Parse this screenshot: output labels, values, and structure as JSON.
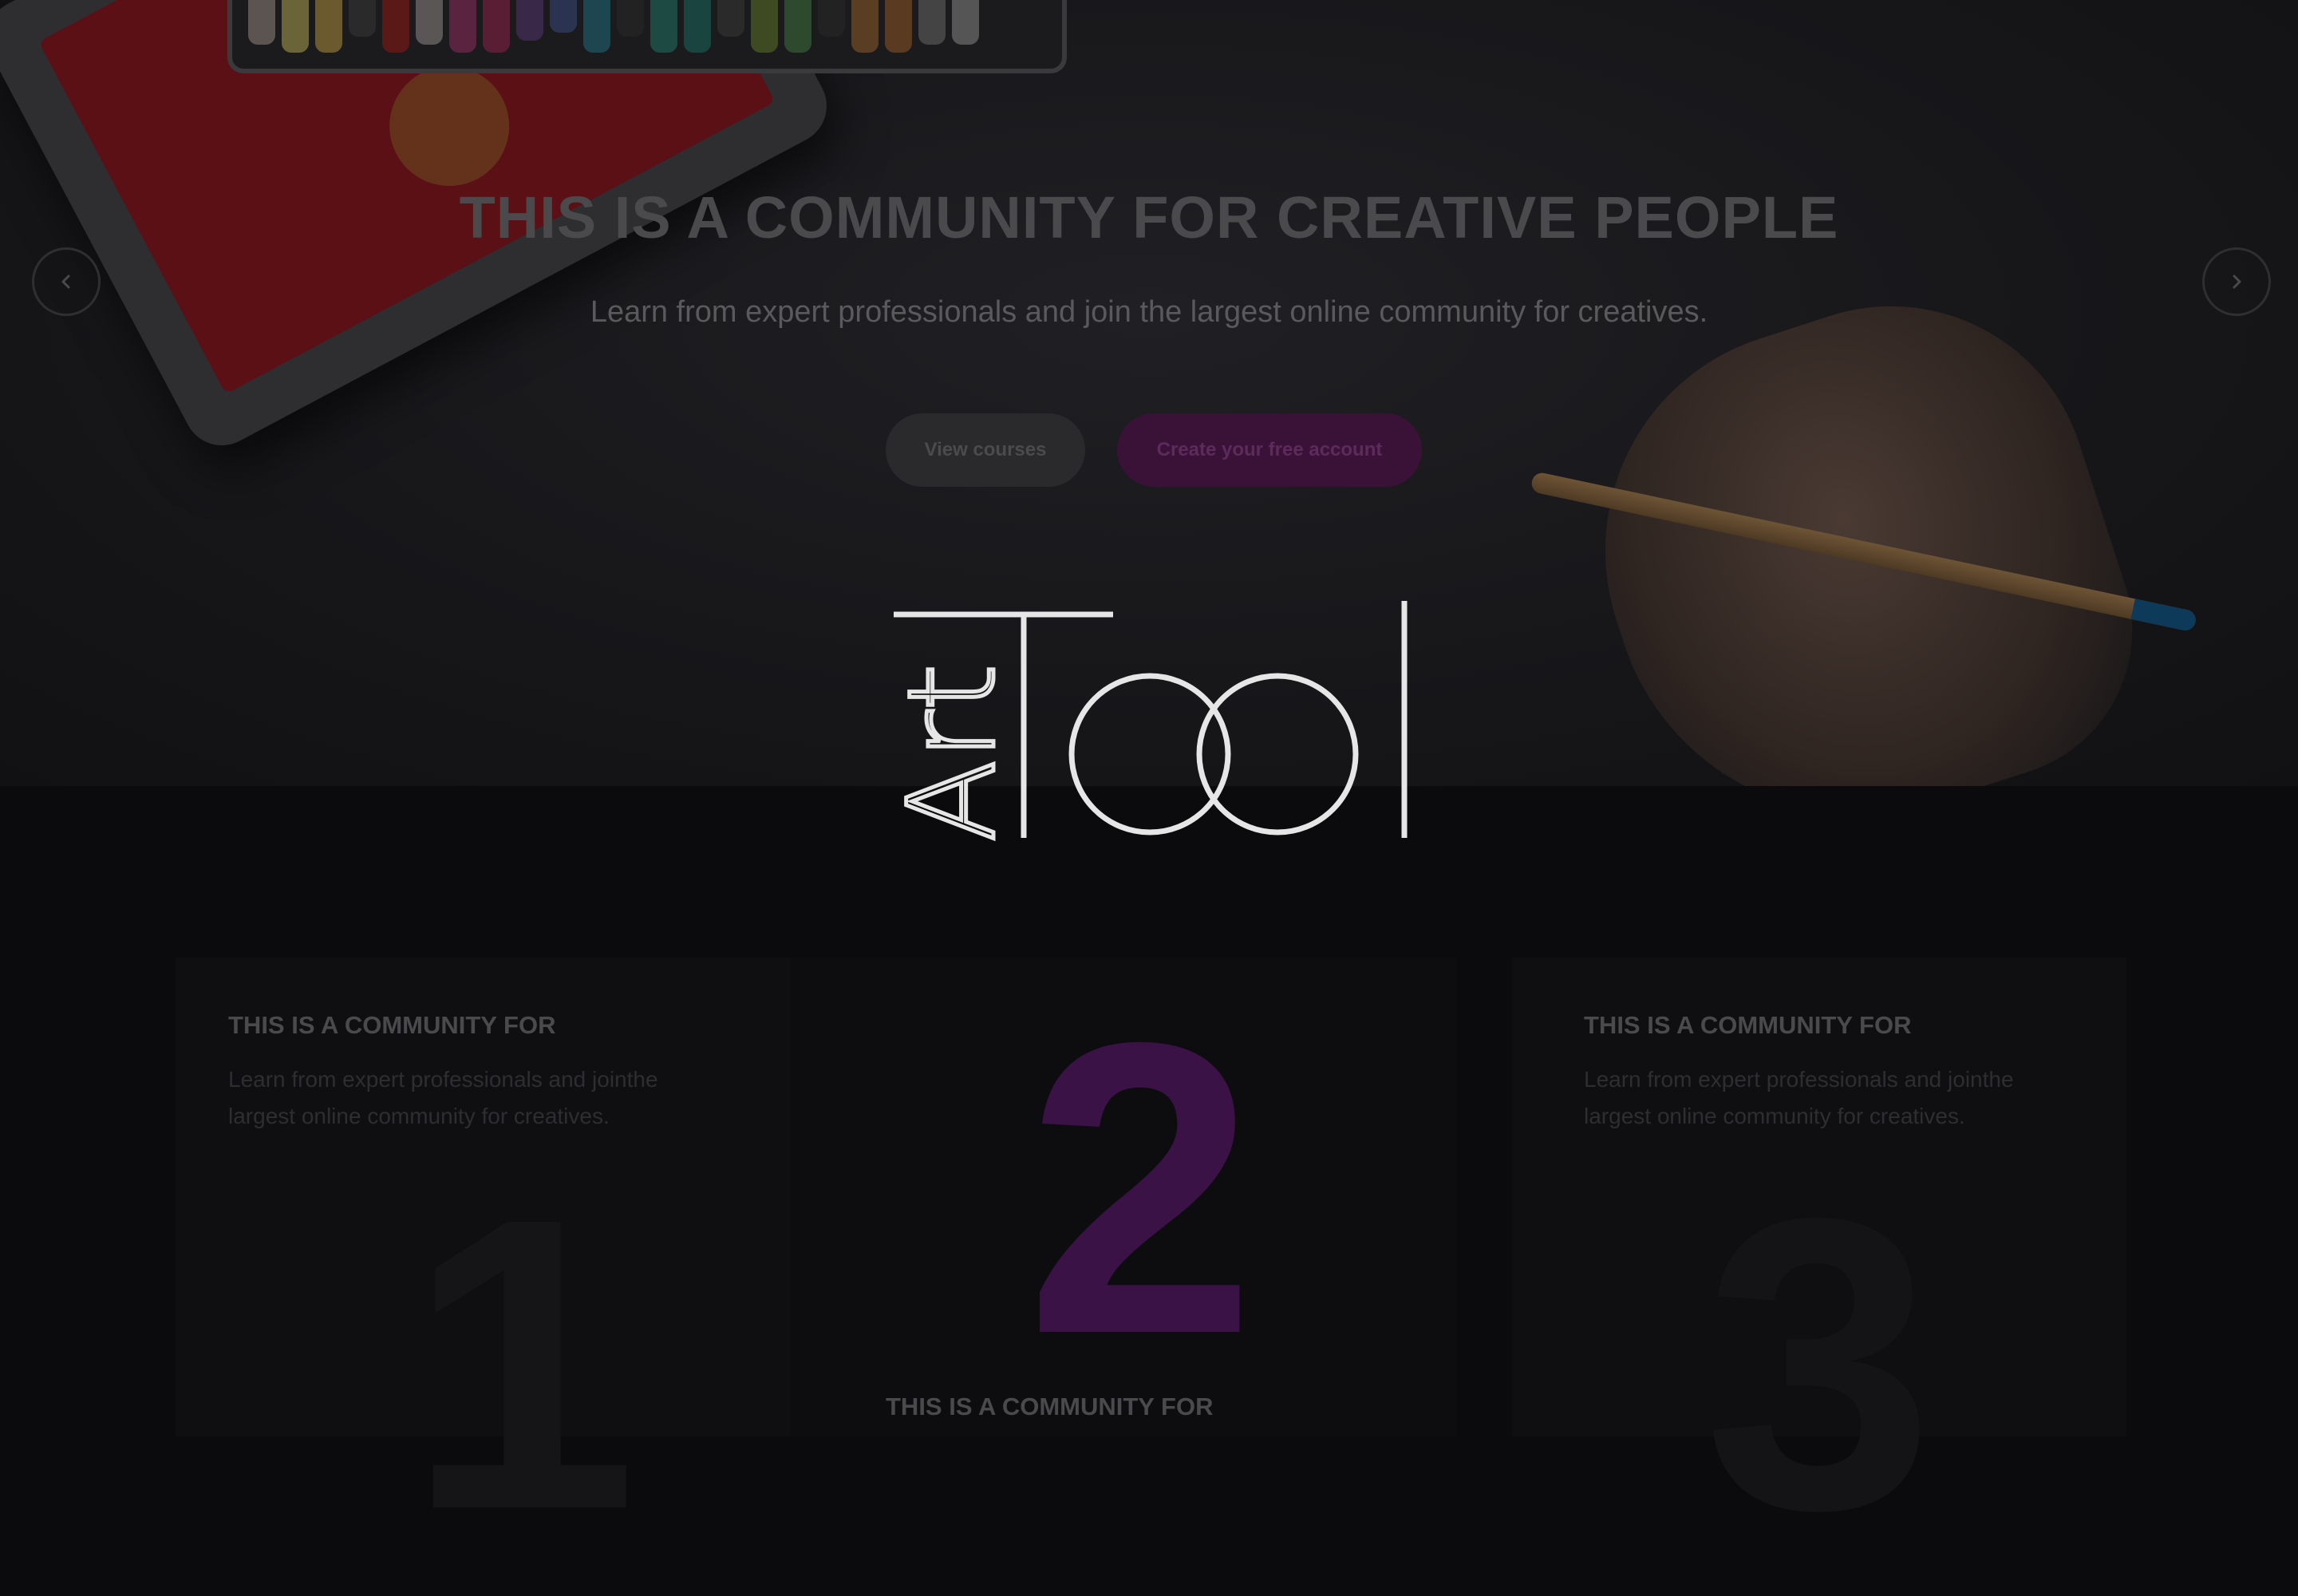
{
  "hero": {
    "headline": "THIS IS A COMMUNITY FOR CREATIVE PEOPLE",
    "subline": "Learn from expert professionals and join the largest online community for creatives.",
    "view_courses_label": "View courses",
    "create_account_label": "Create your free account",
    "prev_icon": "chevron-left-icon",
    "next_icon": "chevron-right-icon"
  },
  "logo": {
    "text_vertical": "Art",
    "text_main": "Tool"
  },
  "features": [
    {
      "number": "1",
      "title": "THIS IS A COMMUNITY FOR",
      "text_line1": "Learn from expert professionals and jointhe",
      "text_line2": "largest online community for creatives."
    },
    {
      "number": "2",
      "title": "THIS IS A COMMUNITY FOR"
    },
    {
      "number": "3",
      "title": "THIS IS A COMMUNITY FOR",
      "text_line1": "Learn from expert professionals and jointhe",
      "text_line2": "largest online community for creatives."
    }
  ],
  "colors": {
    "accent": "#5c1a6a",
    "overlay": "#0b0b0d"
  }
}
